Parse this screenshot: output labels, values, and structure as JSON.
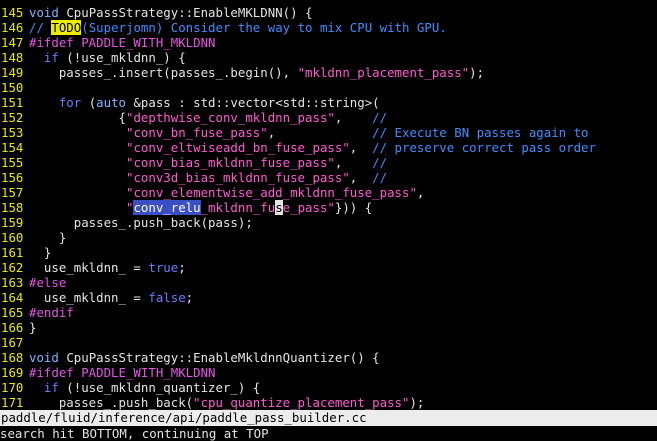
{
  "editor": {
    "lines": [
      {
        "n": "145",
        "s": [
          {
            "c": "t-type",
            "t": "void "
          },
          {
            "c": "t-pl",
            "t": "CpuPassStrategy::EnableMKLDNN() {"
          }
        ]
      },
      {
        "n": "146",
        "s": [
          {
            "c": "t-cmt",
            "t": "// "
          },
          {
            "c": "t-todo",
            "t": "TODO"
          },
          {
            "c": "t-cmt",
            "t": "(Superjomn) Consider the way to mix CPU with GPU."
          }
        ]
      },
      {
        "n": "147",
        "s": [
          {
            "c": "t-pp",
            "t": "#ifdef PADDLE_WITH_MKLDNN"
          }
        ]
      },
      {
        "n": "148",
        "s": [
          {
            "c": "t-pl",
            "t": "  "
          },
          {
            "c": "t-kw",
            "t": "if"
          },
          {
            "c": "t-pl",
            "t": " (!use_mkldnn_) {"
          }
        ]
      },
      {
        "n": "149",
        "s": [
          {
            "c": "t-pl",
            "t": "    passes_.insert(passes_.begin(), "
          },
          {
            "c": "t-str",
            "t": "\"mkldnn_placement_pass\""
          },
          {
            "c": "t-pl",
            "t": ");"
          }
        ]
      },
      {
        "n": "150",
        "s": []
      },
      {
        "n": "151",
        "s": [
          {
            "c": "t-pl",
            "t": "    "
          },
          {
            "c": "t-kw",
            "t": "for"
          },
          {
            "c": "t-pl",
            "t": " ("
          },
          {
            "c": "t-type",
            "t": "auto"
          },
          {
            "c": "t-pl",
            "t": " &pass : std::vector<std::string>("
          }
        ]
      },
      {
        "n": "152",
        "s": [
          {
            "c": "t-pl",
            "t": "            {"
          },
          {
            "c": "t-str",
            "t": "\"depthwise_conv_mkldnn_pass\""
          },
          {
            "c": "t-pl",
            "t": ",    "
          },
          {
            "c": "t-cmt",
            "t": "//"
          }
        ]
      },
      {
        "n": "153",
        "s": [
          {
            "c": "t-pl",
            "t": "             "
          },
          {
            "c": "t-str",
            "t": "\"conv_bn_fuse_pass\""
          },
          {
            "c": "t-pl",
            "t": ",             "
          },
          {
            "c": "t-cmt",
            "t": "// Execute BN passes again to"
          }
        ]
      },
      {
        "n": "154",
        "s": [
          {
            "c": "t-pl",
            "t": "             "
          },
          {
            "c": "t-str",
            "t": "\"conv_eltwiseadd_bn_fuse_pass\""
          },
          {
            "c": "t-pl",
            "t": ",  "
          },
          {
            "c": "t-cmt",
            "t": "// preserve correct pass order"
          }
        ]
      },
      {
        "n": "155",
        "s": [
          {
            "c": "t-pl",
            "t": "             "
          },
          {
            "c": "t-str",
            "t": "\"conv_bias_mkldnn_fuse_pass\""
          },
          {
            "c": "t-pl",
            "t": ",    "
          },
          {
            "c": "t-cmt",
            "t": "//"
          }
        ]
      },
      {
        "n": "156",
        "s": [
          {
            "c": "t-pl",
            "t": "             "
          },
          {
            "c": "t-str",
            "t": "\"conv3d_bias_mkldnn_fuse_pass\""
          },
          {
            "c": "t-pl",
            "t": ",  "
          },
          {
            "c": "t-cmt",
            "t": "//"
          }
        ]
      },
      {
        "n": "157",
        "s": [
          {
            "c": "t-pl",
            "t": "             "
          },
          {
            "c": "t-str",
            "t": "\"conv_elementwise_add_mkldnn_fuse_pass\""
          },
          {
            "c": "t-pl",
            "t": ","
          }
        ]
      },
      {
        "n": "158",
        "s": [
          {
            "c": "t-pl",
            "t": "             "
          },
          {
            "c": "t-str",
            "t": "\""
          },
          {
            "c": "t-sel",
            "t": "conv_relu"
          },
          {
            "c": "t-str",
            "t": "_mkldnn_fu"
          },
          {
            "c": "t-cur",
            "t": "s"
          },
          {
            "c": "t-str",
            "t": "e_pass\""
          },
          {
            "c": "t-pl",
            "t": "})) {"
          }
        ]
      },
      {
        "n": "159",
        "s": [
          {
            "c": "t-pl",
            "t": "      passes_.push_back(pass);"
          }
        ]
      },
      {
        "n": "160",
        "s": [
          {
            "c": "t-pl",
            "t": "    }"
          }
        ]
      },
      {
        "n": "161",
        "s": [
          {
            "c": "t-pl",
            "t": "  }"
          }
        ]
      },
      {
        "n": "162",
        "s": [
          {
            "c": "t-pl",
            "t": "  use_mkldnn_ = "
          },
          {
            "c": "t-kw",
            "t": "true"
          },
          {
            "c": "t-pl",
            "t": ";"
          }
        ]
      },
      {
        "n": "163",
        "s": [
          {
            "c": "t-pp",
            "t": "#else"
          }
        ]
      },
      {
        "n": "164",
        "s": [
          {
            "c": "t-pl",
            "t": "  use_mkldnn_ = "
          },
          {
            "c": "t-kw",
            "t": "false"
          },
          {
            "c": "t-pl",
            "t": ";"
          }
        ]
      },
      {
        "n": "165",
        "s": [
          {
            "c": "t-pp",
            "t": "#endif"
          }
        ]
      },
      {
        "n": "166",
        "s": [
          {
            "c": "t-pl",
            "t": "}"
          }
        ]
      },
      {
        "n": "167",
        "s": []
      },
      {
        "n": "168",
        "s": [
          {
            "c": "t-type",
            "t": "void "
          },
          {
            "c": "t-pl",
            "t": "CpuPassStrategy::EnableMkldnnQuantizer() {"
          }
        ]
      },
      {
        "n": "169",
        "s": [
          {
            "c": "t-pp",
            "t": "#ifdef PADDLE_WITH_MKLDNN"
          }
        ]
      },
      {
        "n": "170",
        "s": [
          {
            "c": "t-pl",
            "t": "  "
          },
          {
            "c": "t-kw",
            "t": "if"
          },
          {
            "c": "t-pl",
            "t": " (!use_mkldnn_quantizer_) {"
          }
        ]
      },
      {
        "n": "171",
        "s": [
          {
            "c": "t-pl",
            "t": "    passes_.push_back("
          },
          {
            "c": "t-str",
            "t": "\"cpu_quantize_placement_pass\""
          },
          {
            "c": "t-pl",
            "t": ");"
          }
        ]
      }
    ]
  },
  "status_bar": {
    "file_path": "paddle/fluid/inference/api/paddle_pass_builder.cc"
  },
  "command_line": {
    "message": "search hit BOTTOM, continuing at TOP"
  },
  "colors": {
    "background": "#000000",
    "line_number": "#e8e800",
    "keyword": "#6b7cff",
    "string": "#ff5ad1",
    "comment": "#3f8dff",
    "preprocessor": "#e455e4",
    "todo_highlight": "#ecec00",
    "search_highlight": "#3a4fc4",
    "status_bar_bg": "#ececec"
  }
}
